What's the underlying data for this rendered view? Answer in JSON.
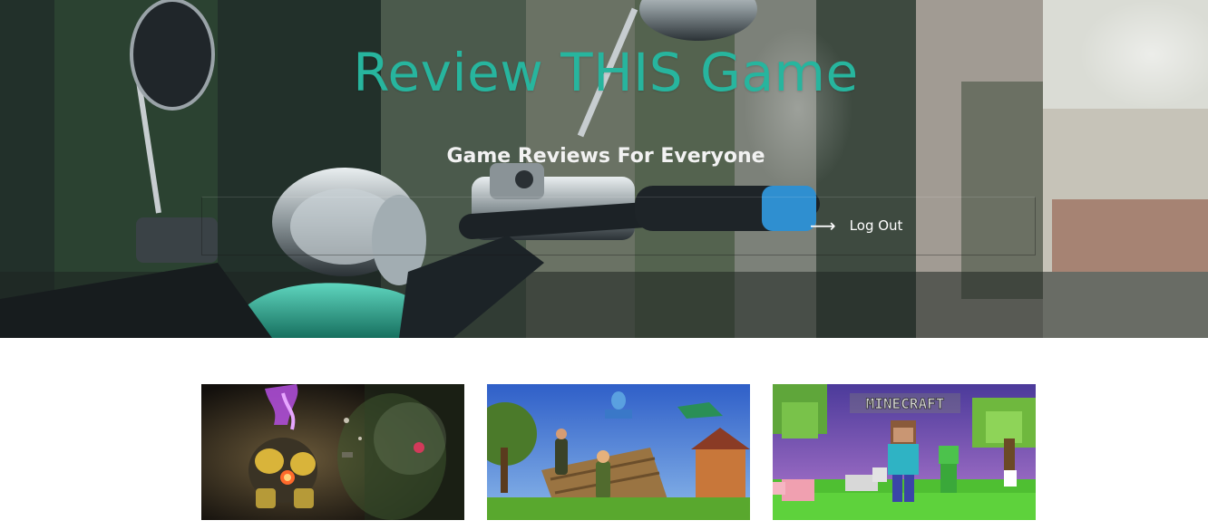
{
  "hero": {
    "title": "Review THIS Game",
    "subtitle": "Game Reviews For Everyone",
    "title_color": "#27b59e"
  },
  "nav": {
    "logout_label": "Log Out",
    "logout_icon": "arrow-right-icon"
  },
  "games": [
    {
      "name": "sci-fi-mech-game",
      "art": "mech-robot-art"
    },
    {
      "name": "fortnite",
      "art": "fortnite-battle-art"
    },
    {
      "name": "minecraft",
      "art": "minecraft-art",
      "logo_text": "MINECRAFT"
    }
  ]
}
